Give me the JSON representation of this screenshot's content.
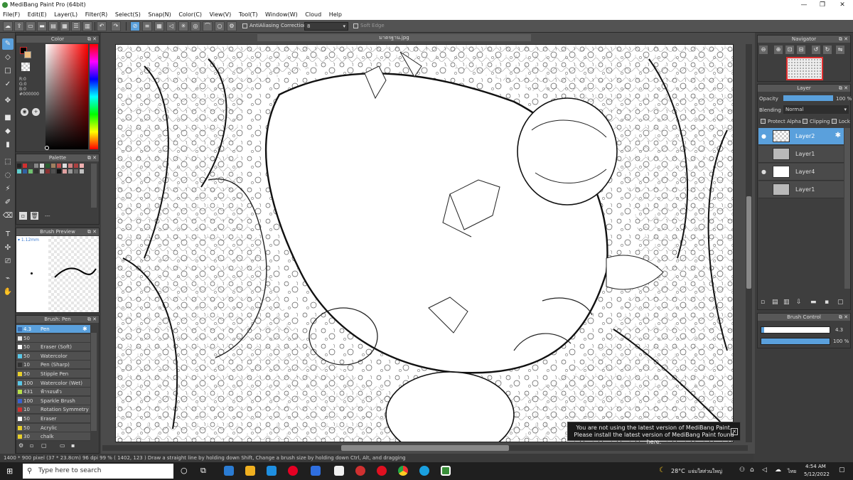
{
  "window": {
    "title": "MediBang Paint Pro (64bit)"
  },
  "menu": [
    "File(F)",
    "Edit(E)",
    "Layer(L)",
    "Filter(R)",
    "Select(S)",
    "Snap(N)",
    "Color(C)",
    "View(V)",
    "Tool(T)",
    "Window(W)",
    "Cloud",
    "Help"
  ],
  "toolbar": {
    "antialiasing": "AntiAliasing",
    "correction_label": "Correction",
    "correction_value": "8",
    "soft_edge": "Soft Edge"
  },
  "color_panel": {
    "title": "Color",
    "r": "R:0",
    "g": "G:0",
    "b": "B:0",
    "hex": "#000000"
  },
  "palette_panel": {
    "title": "Palette",
    "more": "---"
  },
  "brush_preview": {
    "title": "Brush Preview",
    "size": "1.12mm"
  },
  "brush_panel": {
    "title": "Brush: Pen",
    "items": [
      {
        "size": "4.3",
        "name": "Pen",
        "color": "#3b6fb0"
      },
      {
        "size": "50",
        "name": "",
        "color": "#e8e8e8"
      },
      {
        "size": "50",
        "name": "Eraser (Soft)",
        "color": "#ffffff"
      },
      {
        "size": "50",
        "name": "Watercolor",
        "color": "#5ac8e8"
      },
      {
        "size": "10",
        "name": "Pen (Sharp)",
        "color": "#333333"
      },
      {
        "size": "50",
        "name": "Stipple Pen",
        "color": "#e8d02a"
      },
      {
        "size": "100",
        "name": "Watercolor (Wet)",
        "color": "#5ac8e8"
      },
      {
        "size": "431",
        "name": "ฟ้ารอบตัว",
        "color": "#b8e04a"
      },
      {
        "size": "100",
        "name": "Sparkle Brush",
        "color": "#3a60d0"
      },
      {
        "size": "10",
        "name": "Rotation Symmetry I",
        "color": "#d03030"
      },
      {
        "size": "50",
        "name": "Eraser",
        "color": "#ffffff"
      },
      {
        "size": "50",
        "name": "Acrylic",
        "color": "#e8d02a"
      },
      {
        "size": "30",
        "name": "chalk",
        "color": "#e8d02a"
      }
    ]
  },
  "document": {
    "tab": "มาตรฐาน.jpg"
  },
  "navigator": {
    "title": "Navigator"
  },
  "layer_panel": {
    "title": "Layer",
    "opacity_label": "Opacity",
    "opacity_value": "100 %",
    "opacity": 1.0,
    "blending_label": "Blending",
    "blending_value": "Normal",
    "protect_alpha": "Protect Alpha",
    "clipping": "Clipping",
    "lock": "Lock",
    "layers": [
      {
        "name": "Layer2",
        "visible": true,
        "selected": true
      },
      {
        "name": "Layer1",
        "visible": false,
        "selected": false
      },
      {
        "name": "Layer4",
        "visible": true,
        "selected": false
      },
      {
        "name": "Layer1",
        "visible": false,
        "selected": false
      }
    ]
  },
  "brush_control": {
    "title": "Brush Control",
    "size": "4.3",
    "opacity": "100 %",
    "size_level": 0.04,
    "opacity_level": 1.0
  },
  "notification": {
    "line1": "You are not using the latest version of MediBang Paint.",
    "line2": "Please install the latest version of MediBang Paint found here."
  },
  "statusbar": {
    "text": "1400 * 900 pixel   (37 * 23.8cm)  96 dpi  99 %   ( 1402, 123 )   Draw a straight line by holding down Shift, Change a brush size by holding down Ctrl, Alt, and dragging"
  },
  "taskbar": {
    "search_placeholder": "Type here to search",
    "weather": "28°C",
    "location": "แจ่มใสส่วนใหญ่",
    "lang": "ไทย",
    "time": "4:54 AM",
    "date": "5/12/2022"
  }
}
